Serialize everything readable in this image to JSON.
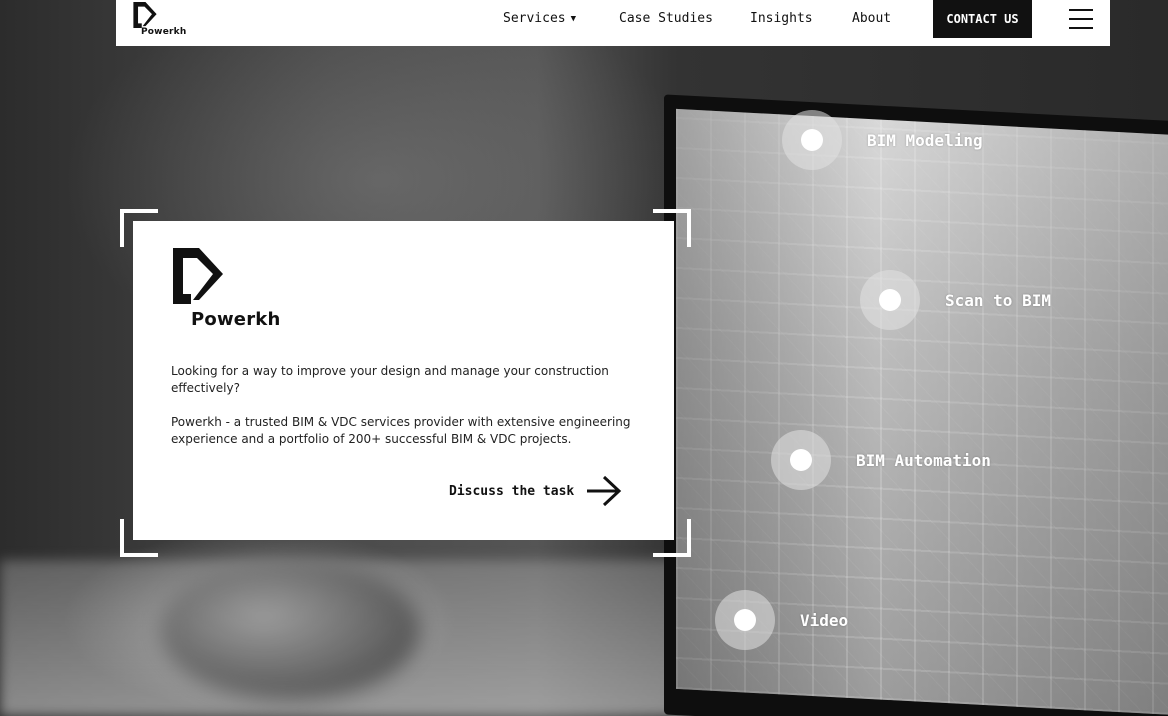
{
  "brand": {
    "name": "Powerkh"
  },
  "nav": {
    "services": "Services",
    "services_caret": "▼",
    "case_studies": "Case Studies",
    "insights": "Insights",
    "about": "About",
    "contact": "CONTACT US"
  },
  "card": {
    "paragraph_1": "Looking for a way to improve your design and manage your construction effectively?",
    "paragraph_2": "Powerkh - a trusted BIM & VDC services provider with extensive engineering experience and a portfolio of 200+ successful BIM & VDC projects.",
    "cta": "Discuss the task"
  },
  "hotspots": [
    {
      "label": "BIM Modeling"
    },
    {
      "label": "Scan to BIM"
    },
    {
      "label": "BIM Automation"
    },
    {
      "label": "Video"
    }
  ],
  "icons": {
    "logo": "powerkh-logo-icon",
    "arrow": "arrow-right-icon",
    "menu": "hamburger-menu-icon",
    "caret": "caret-down-icon"
  },
  "colors": {
    "header_bg": "#ffffff",
    "button_bg": "#111111",
    "button_text": "#ffffff",
    "card_bg": "#ffffff",
    "hotspot_label": "#ffffff"
  }
}
